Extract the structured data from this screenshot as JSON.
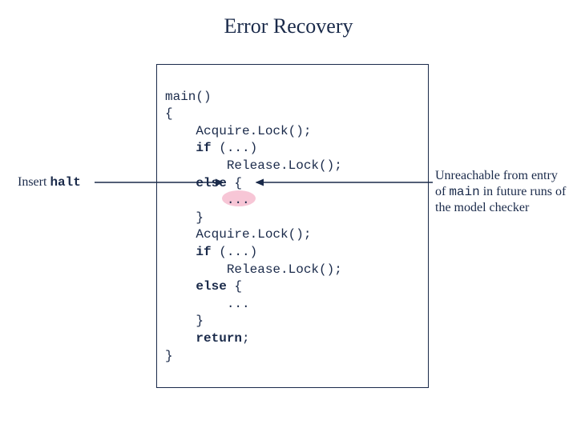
{
  "title": "Error Recovery",
  "left_annotation": {
    "prefix": "Insert ",
    "mono": "halt"
  },
  "right_annotation": {
    "line1_prefix": "Unreachable from entry of ",
    "line2_mono": "main",
    "line2_rest": " in future runs of the model checker"
  },
  "code": {
    "l01": "main()",
    "l02": "{",
    "l03": "    Acquire.Lock();",
    "l04_pre": "    ",
    "l04_kw": "if",
    "l04_post": " (...)",
    "l05": "        Release.Lock();",
    "l06_pre": "    ",
    "l06_kw": "else",
    "l06_post": " {",
    "l07_pre": "        ",
    "l07_dots": "...",
    "l08": "    }",
    "l09": "    Acquire.Lock();",
    "l10_pre": "    ",
    "l10_kw": "if",
    "l10_post": " (...)",
    "l11": "        Release.Lock();",
    "l12_pre": "    ",
    "l12_kw": "else",
    "l12_post": " {",
    "l13": "        ...",
    "l14": "    }",
    "l15_pre": "    ",
    "l15_kw": "return",
    "l15_post": ";",
    "l16": "}"
  }
}
